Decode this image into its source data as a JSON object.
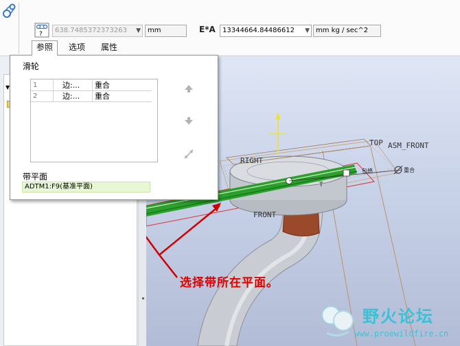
{
  "toolbar": {
    "length_value": "638.7485372373263",
    "length_unit": "mm",
    "ea_label": "E*A",
    "ea_value": "13344664.84486612",
    "ea_unit": "mm kg / sec^2"
  },
  "tabs": [
    {
      "label": "参照",
      "active": true
    },
    {
      "label": "选项",
      "active": false
    },
    {
      "label": "属性",
      "active": false
    }
  ],
  "reference_panel": {
    "pulley_label": "滑轮",
    "rows": [
      {
        "index": "1",
        "type": "边:...",
        "constraint": "重合"
      },
      {
        "index": "2",
        "type": "边:...",
        "constraint": "重合"
      }
    ],
    "belt_plane_label": "带平面",
    "belt_plane_value": "ADTM1:F9(基准平面)"
  },
  "viewport": {
    "datum_labels": [
      "TOP",
      "ASM_FRONT",
      "RIGHT",
      "FRONT"
    ],
    "tag_belt": "包络",
    "tag_coincide": "重合",
    "tag_t": "T"
  },
  "annotation": "选择带所在平面。",
  "watermark": {
    "title": "野火论坛",
    "url": "www.proewildfire.cn"
  },
  "colors": {
    "annotation_red": "#e00000",
    "belt_green": "#1a9a1a",
    "belt_plane_bg": "#e8f8d4",
    "watermark_cyan": "#3cc0d6"
  }
}
